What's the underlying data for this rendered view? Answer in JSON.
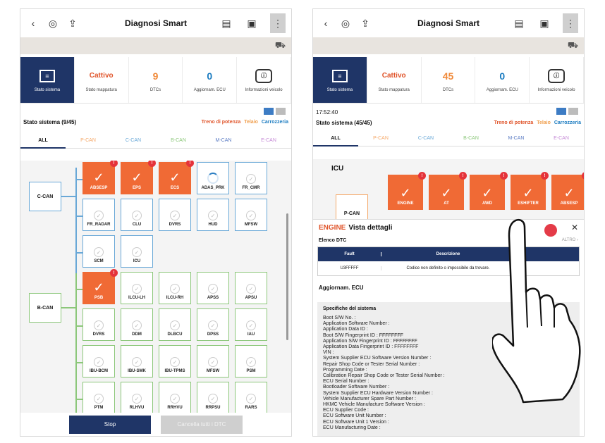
{
  "screen1": {
    "title": "Diagnosi Smart",
    "tiles": [
      {
        "value": "",
        "label": "Stato sistema"
      },
      {
        "value": "Cattivo",
        "label": "Stato mappatura"
      },
      {
        "value": "9",
        "label": "DTCs"
      },
      {
        "value": "0",
        "label": "Aggiornam. ECU"
      },
      {
        "value": "",
        "label": "Informazioni veicolo"
      }
    ],
    "section_title": "Stato sistema (9/45)",
    "categories": [
      "Treno di potenza",
      "Telaio",
      "Carrozzeria"
    ],
    "can_tabs": [
      "ALL",
      "P-CAN",
      "C-CAN",
      "B-CAN",
      "M-CAN",
      "E-CAN"
    ],
    "bus_labels": [
      "C-CAN",
      "B-CAN"
    ],
    "ecus": [
      {
        "name": "ABSESP",
        "fault": true
      },
      {
        "name": "EPS",
        "fault": true
      },
      {
        "name": "ECS",
        "fault": true
      },
      {
        "name": "ADAS_PRK",
        "fault": false
      },
      {
        "name": "FR_CMR",
        "fault": false
      },
      {
        "name": "FR_RADAR",
        "fault": false
      },
      {
        "name": "CLU",
        "fault": false
      },
      {
        "name": "DVRS",
        "fault": false
      },
      {
        "name": "HUD",
        "fault": false
      },
      {
        "name": "MFSW",
        "fault": false
      },
      {
        "name": "SCM",
        "fault": false
      },
      {
        "name": "ICU",
        "fault": false
      },
      {
        "name": "PSB",
        "fault": true
      },
      {
        "name": "ILCU-LH",
        "fault": false
      },
      {
        "name": "ILCU-RH",
        "fault": false
      },
      {
        "name": "APSS",
        "fault": false
      },
      {
        "name": "APSU",
        "fault": false
      },
      {
        "name": "DVRS",
        "fault": false
      },
      {
        "name": "DDM",
        "fault": false
      },
      {
        "name": "DLBCU",
        "fault": false
      },
      {
        "name": "DPSS",
        "fault": false
      },
      {
        "name": "IAU",
        "fault": false
      },
      {
        "name": "IBU-BCM",
        "fault": false
      },
      {
        "name": "IBU-SMK",
        "fault": false
      },
      {
        "name": "IBU-TPMS",
        "fault": false
      },
      {
        "name": "MFSW",
        "fault": false
      },
      {
        "name": "PSM",
        "fault": false
      },
      {
        "name": "PTM",
        "fault": false
      },
      {
        "name": "RLHVU",
        "fault": false
      },
      {
        "name": "RRHVU",
        "fault": false
      },
      {
        "name": "RRPSU",
        "fault": false
      },
      {
        "name": "RARS",
        "fault": false
      }
    ],
    "buttons": {
      "stop": "Stop",
      "clear": "Cancella tutti i DTC"
    }
  },
  "screen2": {
    "title": "Diagnosi Smart",
    "tiles": [
      {
        "value": "",
        "label": "Stato sistema"
      },
      {
        "value": "Cattivo",
        "label": "Stato mappatura"
      },
      {
        "value": "45",
        "label": "DTCs"
      },
      {
        "value": "0",
        "label": "Aggiornam. ECU"
      },
      {
        "value": "",
        "label": "Informazioni veicolo"
      }
    ],
    "time": "17:52:40",
    "section_title": "Stato sistema (45/45)",
    "categories": [
      "Treno di potenza",
      "Telaio",
      "Carrozzeria"
    ],
    "can_tabs": [
      "ALL",
      "P-CAN",
      "C-CAN",
      "B-CAN",
      "M-CAN",
      "E-CAN"
    ],
    "group_label": "ICU",
    "bus_label": "P-CAN",
    "ecus": [
      "ENGINE",
      "AT",
      "AWD",
      "ESHIFTER",
      "ABSESP"
    ],
    "panel": {
      "engine": "ENGINE",
      "title": "Vista dettagli",
      "dtc_list": "Elenco DTC",
      "altro": "ALTRO",
      "col_fault": "Fault",
      "col_desc": "Descrizione",
      "fault_code": "U3FFFFF",
      "fault_desc": "Codice non definito o impossibile da trovare.",
      "ecu_update": "Aggiornam. ECU",
      "specs_title": "Specifiche del sistema",
      "specs": [
        "Boot S/W No. :",
        "Application Software Number :",
        "Application Data ID :",
        "Boot S/W Fingerprint ID : FFFFFFFF",
        "Application S/W Fingerprint ID : FFFFFFFF",
        "Application Data Fingerprint ID : FFFFFFFF",
        "VIN :",
        "System Supplier ECU Software Version Number :",
        "Repair Shop Code or Tester Serial Number :",
        "Programming Date :",
        "Calibration Repair Shop Code or Tester Serial Number :",
        "ECU Serial Number :",
        "Bootloader Software Number :",
        "System Supplier ECU Hardware Version Number :",
        "Vehicle Manufacturer Spare Part Number :",
        "HKMC Vehicle Manufacture Software Version :",
        "ECU Supplier Code :",
        "ECU Software Unit Number :",
        "ECU Software Unit 1 Version :",
        "ECU Manufacturing Date :"
      ]
    }
  },
  "colors": {
    "navy": "#1f3567",
    "fault": "#f06a35",
    "c_can": "#69a8d7",
    "b_can": "#8cc77a",
    "badge": "#e5333a"
  }
}
